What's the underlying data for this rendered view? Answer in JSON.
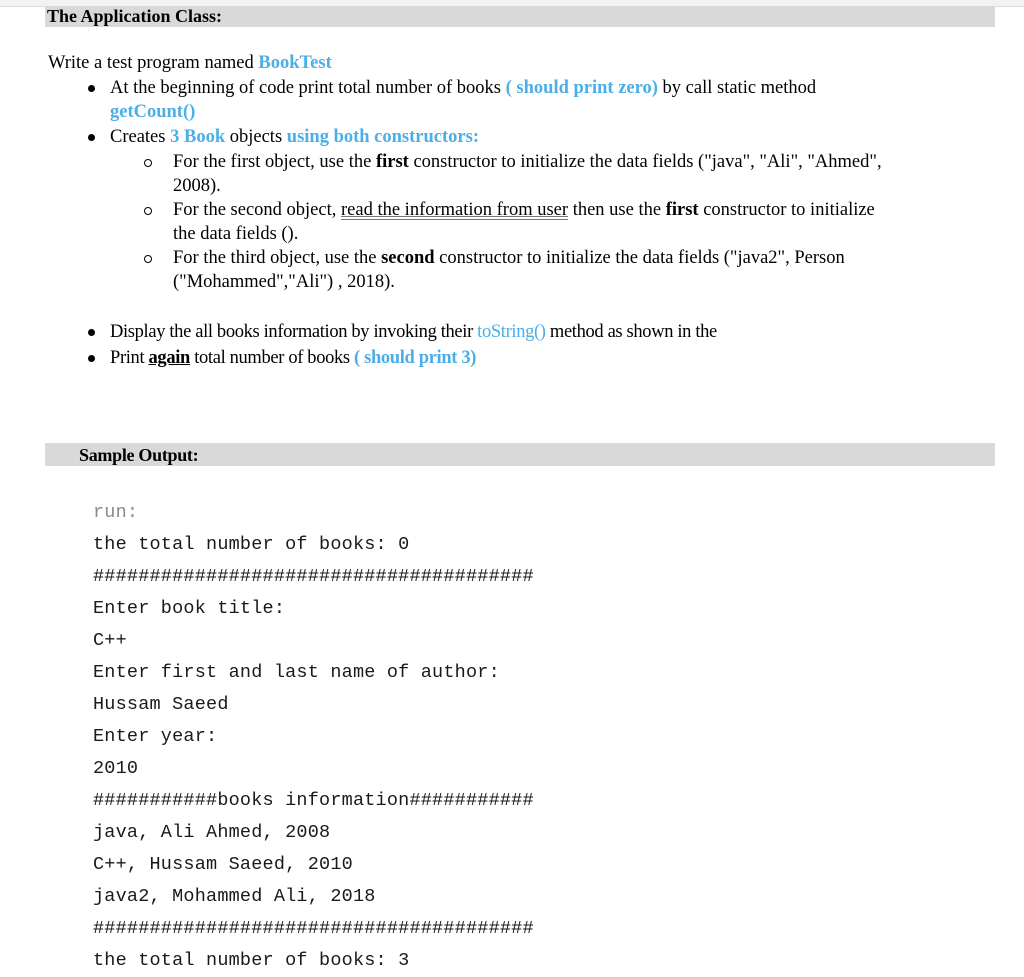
{
  "document": {
    "section_app_title": "The Application Class:",
    "intro": {
      "prefix": "Write a test program named ",
      "class_name": "BookTest"
    },
    "bullets": [
      {
        "line1_prefix": "At the beginning of code print total number of books ",
        "line1_highlight": "( should print zero)",
        "line1_suffix": " by call static method",
        "line2_highlight": "getCount()"
      },
      {
        "prefix": "Creates ",
        "highlight1": "3 Book",
        "middle": " objects ",
        "highlight2": "using both constructors:"
      }
    ],
    "sub_bullets": [
      {
        "line1_prefix": "For the first object, use the ",
        "line1_bold": "first",
        "line1_suffix": " constructor to initialize the data fields (\"java\", \"Ali\", \"Ahmed\",",
        "line2": "2008)."
      },
      {
        "line1_prefix": "For the second object, ",
        "line1_underlined": "read the information from user",
        "line1_middle": " then use the ",
        "line1_bold": "first",
        "line1_suffix": " constructor to initialize",
        "line2": "the data fields ()."
      },
      {
        "line1_prefix": "For the third object, use the ",
        "line1_bold": "second",
        "line1_suffix": " constructor to initialize the data fields (\"java2\", Person",
        "line2": "(\"Mohammed\",\"Ali\") , 2018)."
      }
    ],
    "bullets_after": [
      {
        "prefix": "Display the all books information by invoking their ",
        "highlight": "toString()",
        "suffix": " method as shown in the"
      },
      {
        "prefix": "Print ",
        "underlined_bold": "again",
        "middle": " total number of books ",
        "highlight": "( should print 3)"
      }
    ],
    "section_sample_title": "Sample Output:"
  },
  "console": {
    "lines": [
      "run:",
      "the total number of books: 0",
      "#######################################",
      "Enter book title:",
      "C++",
      "Enter first and last name of author:",
      "Hussam Saeed",
      "Enter year:",
      "2010",
      "###########books information###########",
      "java, Ali Ahmed, 2008",
      "C++, Hussam Saeed, 2010",
      "java2, Mohammed Ali, 2018",
      "#######################################",
      "the total number of books: 3"
    ]
  },
  "colors": {
    "accent_blue": "#4aaee8",
    "header_gray": "#d9d9d9"
  }
}
